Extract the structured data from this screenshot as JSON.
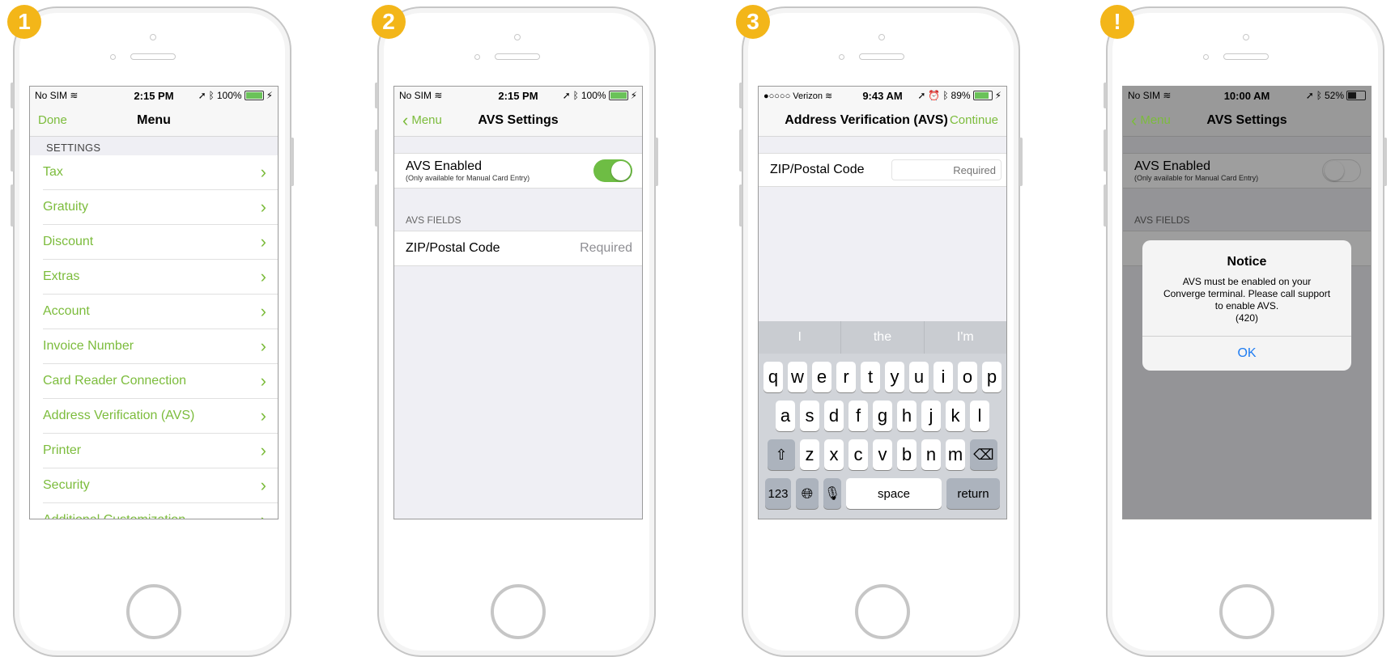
{
  "colors": {
    "accent_green": "#7cbc3c",
    "badge_yellow": "#f3b619",
    "alert_blue": "#1e7cf2"
  },
  "screens": [
    {
      "badge": "1",
      "status": {
        "carrier": "No SIM",
        "time": "2:15 PM",
        "battery": "100%",
        "battery_level": 1.0
      },
      "nav": {
        "left": "Done",
        "title": "Menu"
      },
      "section": "SETTINGS",
      "items": [
        "Tax",
        "Gratuity",
        "Discount",
        "Extras",
        "Account",
        "Invoice Number",
        "Card Reader Connection",
        "Address Verification (AVS)",
        "Printer",
        "Security",
        "Additional Customization"
      ]
    },
    {
      "badge": "2",
      "status": {
        "carrier": "No SIM",
        "time": "2:15 PM",
        "battery": "100%",
        "battery_level": 1.0
      },
      "nav": {
        "back": "Menu",
        "title": "AVS Settings"
      },
      "avs_enabled": {
        "label": "AVS Enabled",
        "sub": "(Only available for Manual Card Entry)",
        "on": true
      },
      "fields_header": "AVS FIELDS",
      "zip": {
        "label": "ZIP/Postal Code",
        "value": "Required"
      }
    },
    {
      "badge": "3",
      "status": {
        "carrier": "●○○○○ Verizon",
        "time": "9:43 AM",
        "battery": "89%",
        "battery_level": 0.89
      },
      "nav": {
        "title": "Address Verification (AVS)",
        "right": "Continue"
      },
      "zip": {
        "label": "ZIP/Postal Code",
        "placeholder": "Required"
      },
      "keyboard": {
        "suggestions": [
          "I",
          "the",
          "I'm"
        ],
        "row1": [
          "q",
          "w",
          "e",
          "r",
          "t",
          "y",
          "u",
          "i",
          "o",
          "p"
        ],
        "row2": [
          "a",
          "s",
          "d",
          "f",
          "g",
          "h",
          "j",
          "k",
          "l"
        ],
        "row3": [
          "z",
          "x",
          "c",
          "v",
          "b",
          "n",
          "m"
        ],
        "numbers": "123",
        "space": "space",
        "return": "return"
      }
    },
    {
      "badge": "!",
      "status": {
        "carrier": "No SIM",
        "time": "10:00 AM",
        "battery": "52%",
        "battery_level": 0.52
      },
      "nav": {
        "back": "Menu",
        "title": "AVS Settings"
      },
      "avs_enabled": {
        "label": "AVS Enabled",
        "sub": "(Only available for Manual Card Entry)",
        "on": false
      },
      "fields_header": "AVS FIELDS",
      "alert": {
        "title": "Notice",
        "line1": "AVS must be enabled on your",
        "line2": "Converge terminal. Please call support",
        "line3": "to enable AVS.",
        "code": "(420)",
        "button": "OK"
      }
    }
  ]
}
